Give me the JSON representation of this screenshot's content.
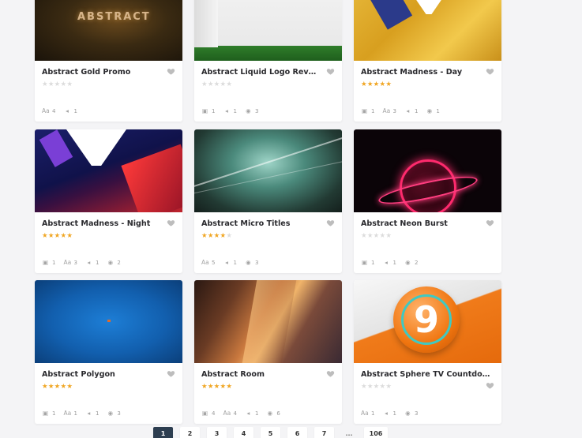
{
  "cards": [
    {
      "title": "Abstract Gold Promo",
      "rating": 0,
      "meta": [
        {
          "icon": "text-icon",
          "sym": "Aa",
          "count": "4"
        },
        {
          "icon": "audio-icon",
          "sym": "◂",
          "count": "1"
        }
      ],
      "thumb_text": "ABSTRACT"
    },
    {
      "title": "Abstract Liquid Logo Reveal",
      "rating": 0,
      "meta": [
        {
          "icon": "camera-icon",
          "sym": "▣",
          "count": "1"
        },
        {
          "icon": "audio-icon",
          "sym": "◂",
          "count": "1"
        },
        {
          "icon": "color-icon",
          "sym": "◉",
          "count": "3"
        }
      ]
    },
    {
      "title": "Abstract Madness - Day",
      "rating": 5,
      "meta": [
        {
          "icon": "camera-icon",
          "sym": "▣",
          "count": "1"
        },
        {
          "icon": "text-icon",
          "sym": "Aa",
          "count": "3"
        },
        {
          "icon": "audio-icon",
          "sym": "◂",
          "count": "1"
        },
        {
          "icon": "color-icon",
          "sym": "◉",
          "count": "1"
        }
      ]
    },
    {
      "title": "Abstract Madness - Night",
      "rating": 5,
      "meta": [
        {
          "icon": "camera-icon",
          "sym": "▣",
          "count": "1"
        },
        {
          "icon": "text-icon",
          "sym": "Aa",
          "count": "3"
        },
        {
          "icon": "audio-icon",
          "sym": "◂",
          "count": "1"
        },
        {
          "icon": "color-icon",
          "sym": "◉",
          "count": "2"
        }
      ]
    },
    {
      "title": "Abstract Micro Titles",
      "rating": 4,
      "meta": [
        {
          "icon": "text-icon",
          "sym": "Aa",
          "count": "5"
        },
        {
          "icon": "audio-icon",
          "sym": "◂",
          "count": "1"
        },
        {
          "icon": "color-icon",
          "sym": "◉",
          "count": "3"
        }
      ]
    },
    {
      "title": "Abstract Neon Burst",
      "rating": 0,
      "meta": [
        {
          "icon": "camera-icon",
          "sym": "▣",
          "count": "1"
        },
        {
          "icon": "audio-icon",
          "sym": "◂",
          "count": "1"
        },
        {
          "icon": "color-icon",
          "sym": "◉",
          "count": "2"
        }
      ]
    },
    {
      "title": "Abstract Polygon",
      "rating": 5,
      "meta": [
        {
          "icon": "camera-icon",
          "sym": "▣",
          "count": "1"
        },
        {
          "icon": "text-icon",
          "sym": "Aa",
          "count": "1"
        },
        {
          "icon": "audio-icon",
          "sym": "◂",
          "count": "1"
        },
        {
          "icon": "color-icon",
          "sym": "◉",
          "count": "3"
        }
      ]
    },
    {
      "title": "Abstract Room",
      "rating": 5,
      "meta": [
        {
          "icon": "camera-icon",
          "sym": "▣",
          "count": "4"
        },
        {
          "icon": "text-icon",
          "sym": "Aa",
          "count": "4"
        },
        {
          "icon": "audio-icon",
          "sym": "◂",
          "count": "1"
        },
        {
          "icon": "color-icon",
          "sym": "◉",
          "count": "6"
        }
      ]
    },
    {
      "title": "Abstract Sphere TV Countdown",
      "rating": 0,
      "meta": [
        {
          "icon": "text-icon",
          "sym": "Aa",
          "count": "1"
        },
        {
          "icon": "audio-icon",
          "sym": "◂",
          "count": "1"
        },
        {
          "icon": "color-icon",
          "sym": "◉",
          "count": "3"
        }
      ],
      "thumb_text": "9"
    }
  ],
  "pagination": {
    "pages": [
      "1",
      "2",
      "3",
      "4",
      "5",
      "6",
      "7"
    ],
    "ellipsis": "...",
    "last": "106",
    "current": "1"
  },
  "colors": {
    "star_on": "#f0a623",
    "star_off": "#dcdcdc",
    "active_page": "#2d3e50"
  }
}
